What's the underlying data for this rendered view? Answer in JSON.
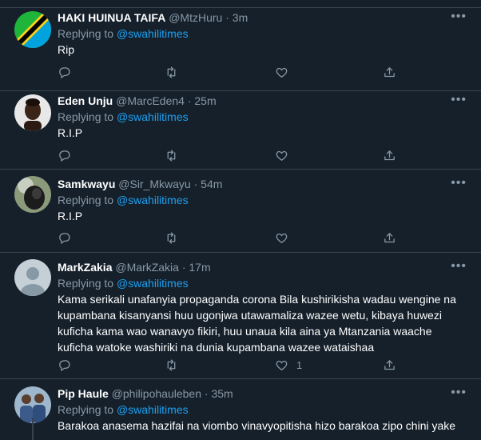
{
  "tweets": [
    {
      "name": "HAKI HUINUA TAIFA",
      "handle": "@MtzHuru",
      "time": "3m",
      "replying_prefix": "Replying to",
      "replying_to": "@swahilitimes",
      "text": "Rip",
      "avatar": "tanzania-flag",
      "likes": ""
    },
    {
      "name": "Eden Unju",
      "handle": "@MarcEden4",
      "time": "25m",
      "replying_prefix": "Replying to",
      "replying_to": "@swahilitimes",
      "text": "R.I.P",
      "avatar": "person-photo",
      "likes": ""
    },
    {
      "name": "Samkwayu",
      "handle": "@Sir_Mkwayu",
      "time": "54m",
      "replying_prefix": "Replying to",
      "replying_to": "@swahilitimes",
      "text": "R.I.P",
      "avatar": "animal-photo",
      "likes": ""
    },
    {
      "name": "MarkZakia",
      "handle": "@MarkZakia",
      "time": "17m",
      "replying_prefix": "Replying to",
      "replying_to": "@swahilitimes",
      "text": "Kama serikali unafanyia propaganda corona Bila kushirikisha wadau wengine na kupambana kisanyansi huu ugonjwa utawamaliza wazee wetu, kibaya huwezi kuficha kama wao wanavyo fikiri, huu unaua kila aina ya Mtanzania waache kuficha watoke washiriki na dunia kupambana wazee wataishaa",
      "avatar": "default-avatar",
      "likes": "1"
    },
    {
      "name": "Pip Haule",
      "handle": "@philipohauleben",
      "time": "35m",
      "replying_prefix": "Replying to",
      "replying_to": "@swahilitimes",
      "text": "Barakoa anasema hazifai na viombo vinavyopitisha hizo barakoa zipo chini yake",
      "avatar": "group-photo",
      "likes": ""
    }
  ],
  "ui": {
    "more_glyph": "•••",
    "dot": "·"
  },
  "colors": {
    "background": "#15202b",
    "secondary_text": "#8899a6",
    "link": "#1da1f2",
    "border": "#38444d"
  }
}
